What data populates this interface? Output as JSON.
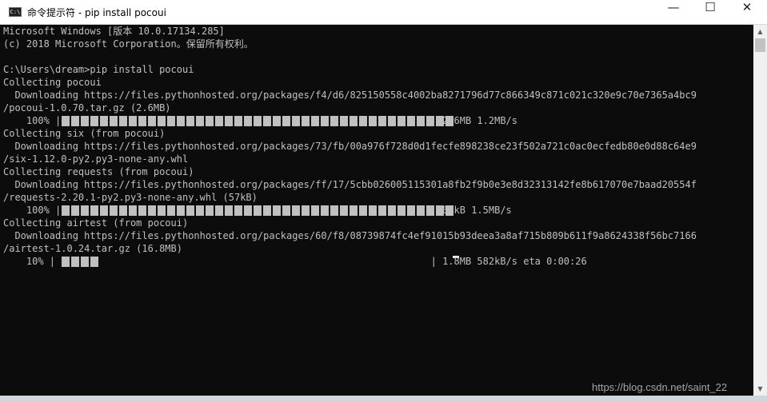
{
  "window": {
    "title": "命令提示符 - pip  install pocoui",
    "icon": "cmd-app-icon",
    "icon_text": "C:\\",
    "controls": {
      "minimize": "—",
      "maximize": "☐",
      "close": "✕"
    }
  },
  "console": {
    "lines": [
      "Microsoft Windows [版本 10.0.17134.285]",
      "(c) 2018 Microsoft Corporation。保留所有权利。",
      "",
      "C:\\Users\\dream>pip install pocoui",
      "Collecting pocoui",
      "  Downloading https://files.pythonhosted.org/packages/f4/d6/825150558c4002ba8271796d77c866349c871c021c320e9c70e7365a4bc9",
      "/pocoui-1.0.70.tar.gz (2.6MB)",
      "    100% |                                                                | 2.6MB 1.2MB/s",
      "Collecting six (from pocoui)",
      "  Downloading https://files.pythonhosted.org/packages/73/fb/00a976f728d0d1fecfe898238ce23f502a721c0ac0ecfedb80e0d88c64e9",
      "/six-1.12.0-py2.py3-none-any.whl",
      "Collecting requests (from pocoui)",
      "  Downloading https://files.pythonhosted.org/packages/ff/17/5cbb026005115301a8fb2f9b0e3e8d32313142fe8b617070e7baad20554f",
      "/requests-2.20.1-py2.py3-none-any.whl (57kB)",
      "    100% |                                                                | 61kB 1.5MB/s",
      "Collecting airtest (from pocoui)",
      "  Downloading https://files.pythonhosted.org/packages/60/f8/08739874fc4ef91015b93deea3a8af715b809b611f9a8624338f56bc7166",
      "/airtest-1.0.24.tar.gz (16.8MB)",
      "    10% |                                                                 | 1.8MB 582kB/s eta 0:00:26"
    ],
    "progress_bars": [
      {
        "line": 7,
        "fraction": 1.0
      },
      {
        "line": 14,
        "fraction": 1.0
      },
      {
        "line": 18,
        "fraction": 0.1
      }
    ]
  },
  "watermark": "https://blog.csdn.net/saint_22",
  "scrollbar": {
    "up": "▲",
    "down": "▼"
  },
  "colors": {
    "console_bg": "#0c0c0c",
    "console_text": "#c0c0c0",
    "titlebar_bg": "#ffffff"
  }
}
